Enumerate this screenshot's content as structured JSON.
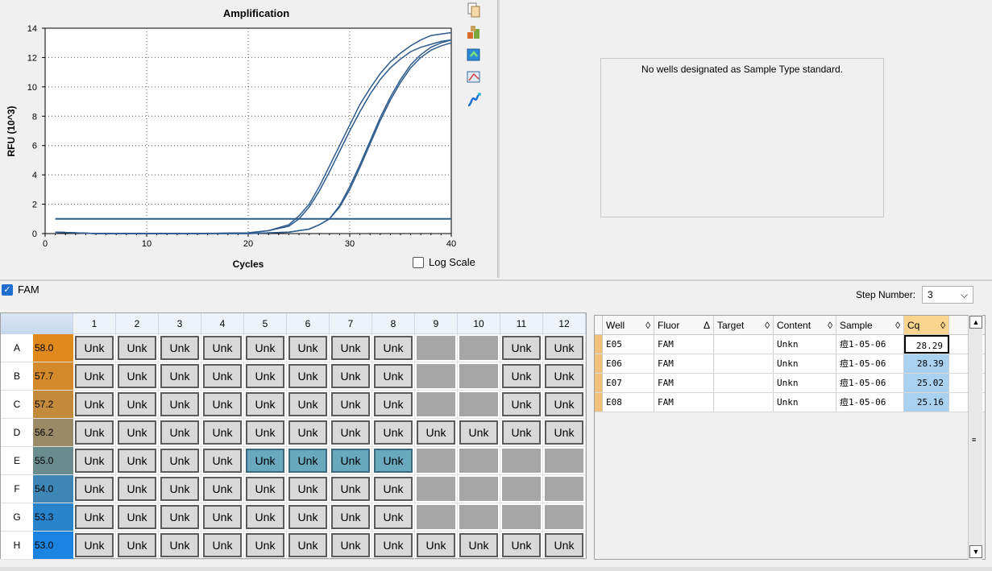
{
  "chart": {
    "title": "Amplification",
    "xlabel": "Cycles",
    "ylabel": "RFU (10^3)",
    "x_ticks": [
      "0",
      "10",
      "20",
      "30",
      "40"
    ],
    "y_ticks": [
      "0",
      "2",
      "4",
      "6",
      "8",
      "10",
      "12",
      "14"
    ],
    "log_scale_label": "Log Scale",
    "line_color": "#2d5b8c"
  },
  "chart_data": {
    "type": "line",
    "title": "Amplification",
    "xlabel": "Cycles",
    "ylabel": "RFU (10^3)",
    "xlim": [
      0,
      40
    ],
    "ylim": [
      0,
      14
    ],
    "grid": true,
    "series": [
      {
        "x": [
          1,
          5,
          10,
          15,
          20,
          22,
          24,
          25,
          26,
          27,
          28,
          29,
          30,
          31,
          32,
          33,
          34,
          35,
          36,
          37,
          38,
          39,
          40
        ],
        "values": [
          0.1,
          0,
          0,
          0,
          0.05,
          0.2,
          0.6,
          1.2,
          2.0,
          3.2,
          4.6,
          6.0,
          7.4,
          8.8,
          9.9,
          10.9,
          11.7,
          12.3,
          12.8,
          13.2,
          13.5,
          13.6,
          13.7
        ]
      },
      {
        "x": [
          1,
          5,
          10,
          15,
          20,
          22,
          24,
          25,
          26,
          27,
          28,
          29,
          30,
          31,
          32,
          33,
          34,
          35,
          36,
          37,
          38,
          39,
          40
        ],
        "values": [
          0.1,
          0,
          0,
          0,
          0.05,
          0.2,
          0.5,
          1.0,
          1.8,
          2.9,
          4.2,
          5.6,
          7.0,
          8.3,
          9.5,
          10.5,
          11.3,
          11.9,
          12.4,
          12.7,
          12.9,
          13.1,
          13.2
        ]
      },
      {
        "x": [
          1,
          5,
          10,
          15,
          20,
          24,
          26,
          27,
          28,
          29,
          30,
          31,
          32,
          33,
          34,
          35,
          36,
          37,
          38,
          39,
          40
        ],
        "values": [
          0.1,
          0,
          0,
          0,
          0,
          0.1,
          0.3,
          0.6,
          1.0,
          1.8,
          3.0,
          4.5,
          6.1,
          7.7,
          9.1,
          10.3,
          11.3,
          12.0,
          12.5,
          12.8,
          13.0
        ]
      },
      {
        "x": [
          1,
          5,
          10,
          15,
          20,
          24,
          26,
          27,
          28,
          29,
          30,
          31,
          32,
          33,
          34,
          35,
          36,
          37,
          38,
          39,
          40
        ],
        "values": [
          0.1,
          0,
          0,
          0,
          0,
          0.1,
          0.3,
          0.6,
          1.0,
          1.9,
          3.2,
          4.7,
          6.3,
          7.9,
          9.3,
          10.5,
          11.5,
          12.2,
          12.7,
          13.0,
          13.2
        ]
      },
      {
        "x": [
          1,
          40
        ],
        "values": [
          1.0,
          1.0
        ]
      }
    ]
  },
  "standard_panel": {
    "message": "No wells designated as Sample Type standard."
  },
  "fluor_toggle": {
    "label": "FAM",
    "checked": true
  },
  "step": {
    "label": "Step Number:",
    "value": "3"
  },
  "plate": {
    "columns": [
      "1",
      "2",
      "3",
      "4",
      "5",
      "6",
      "7",
      "8",
      "9",
      "10",
      "11",
      "12"
    ],
    "rows": [
      {
        "letter": "A",
        "temp": "58.0",
        "color": "#e08a1e",
        "wells": [
          "Unk",
          "Unk",
          "Unk",
          "Unk",
          "Unk",
          "Unk",
          "Unk",
          "Unk",
          "",
          "",
          "Unk",
          "Unk"
        ]
      },
      {
        "letter": "B",
        "temp": "57.7",
        "color": "#d48a2a",
        "wells": [
          "Unk",
          "Unk",
          "Unk",
          "Unk",
          "Unk",
          "Unk",
          "Unk",
          "Unk",
          "",
          "",
          "Unk",
          "Unk"
        ]
      },
      {
        "letter": "C",
        "temp": "57.2",
        "color": "#c48a3c",
        "wells": [
          "Unk",
          "Unk",
          "Unk",
          "Unk",
          "Unk",
          "Unk",
          "Unk",
          "Unk",
          "",
          "",
          "Unk",
          "Unk"
        ]
      },
      {
        "letter": "D",
        "temp": "56.2",
        "color": "#9a8a66",
        "wells": [
          "Unk",
          "Unk",
          "Unk",
          "Unk",
          "Unk",
          "Unk",
          "Unk",
          "Unk",
          "Unk",
          "Unk",
          "Unk",
          "Unk"
        ]
      },
      {
        "letter": "E",
        "temp": "55.0",
        "color": "#6a8c8e",
        "wells": [
          "Unk",
          "Unk",
          "Unk",
          "Unk",
          "Unk",
          "Unk",
          "Unk",
          "Unk",
          "",
          "",
          "",
          ""
        ]
      },
      {
        "letter": "F",
        "temp": "54.0",
        "color": "#3d86b6",
        "wells": [
          "Unk",
          "Unk",
          "Unk",
          "Unk",
          "Unk",
          "Unk",
          "Unk",
          "Unk",
          "",
          "",
          "",
          ""
        ]
      },
      {
        "letter": "G",
        "temp": "53.3",
        "color": "#2a84cc",
        "wells": [
          "Unk",
          "Unk",
          "Unk",
          "Unk",
          "Unk",
          "Unk",
          "Unk",
          "Unk",
          "",
          "",
          "",
          ""
        ]
      },
      {
        "letter": "H",
        "temp": "53.0",
        "color": "#1a84e0",
        "wells": [
          "Unk",
          "Unk",
          "Unk",
          "Unk",
          "Unk",
          "Unk",
          "Unk",
          "Unk",
          "Unk",
          "Unk",
          "Unk",
          "Unk"
        ]
      }
    ],
    "selected_wells": [
      "E5",
      "E6",
      "E7",
      "E8"
    ]
  },
  "table": {
    "headers": [
      {
        "label": "Well",
        "sort": "◊"
      },
      {
        "label": "Fluor",
        "sort": "Δ"
      },
      {
        "label": "Target",
        "sort": "◊"
      },
      {
        "label": "Content",
        "sort": "◊"
      },
      {
        "label": "Sample",
        "sort": "◊"
      },
      {
        "label": "Cq",
        "sort": "◊"
      }
    ],
    "rows": [
      {
        "well": "E05",
        "fluor": "FAM",
        "target": "",
        "content": "Unkn",
        "sample": "痘1-05-06",
        "cq": "28.29"
      },
      {
        "well": "E06",
        "fluor": "FAM",
        "target": "",
        "content": "Unkn",
        "sample": "痘1-05-06",
        "cq": "28.39"
      },
      {
        "well": "E07",
        "fluor": "FAM",
        "target": "",
        "content": "Unkn",
        "sample": "痘1-05-06",
        "cq": "25.02"
      },
      {
        "well": "E08",
        "fluor": "FAM",
        "target": "",
        "content": "Unkn",
        "sample": "痘1-05-06",
        "cq": "25.16"
      }
    ]
  },
  "icons": [
    "copy-icon",
    "export-icon",
    "refresh-icon",
    "chart-settings-icon",
    "curve-icon"
  ]
}
